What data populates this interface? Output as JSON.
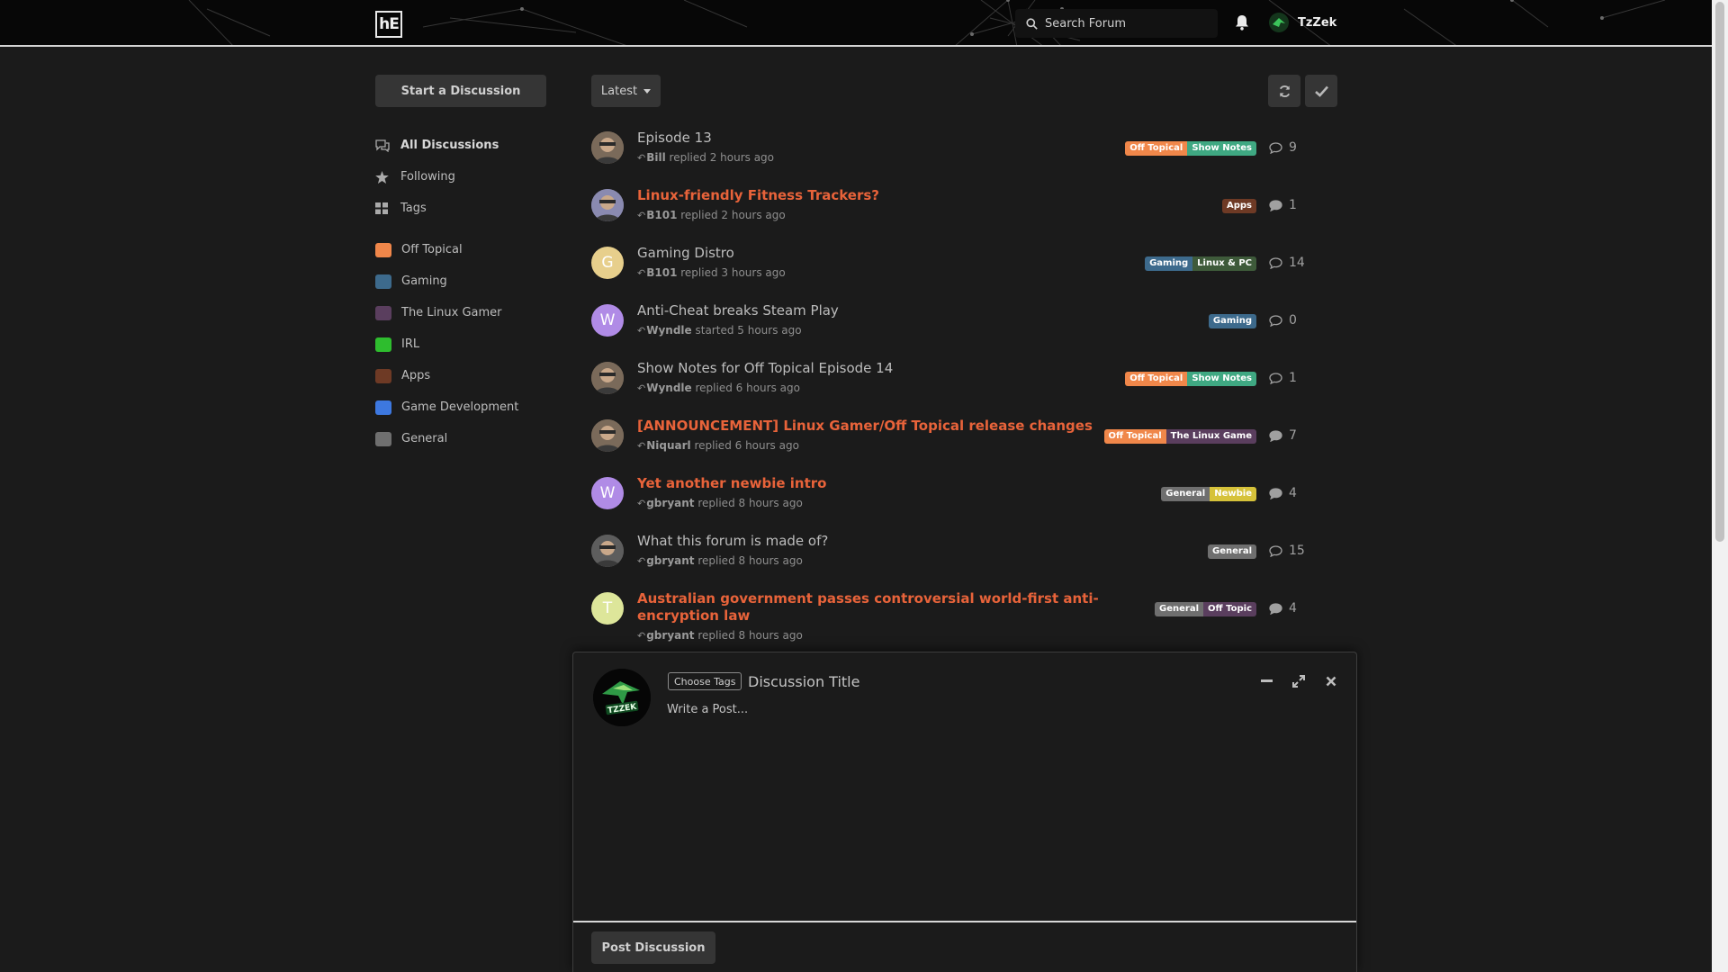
{
  "colors": {
    "accent_unread": "#e8633a",
    "background": "#1b1b1b",
    "header_bg": "#070707"
  },
  "header": {
    "logo_text": "hE",
    "search_placeholder": "Search Forum",
    "username": "TzZek"
  },
  "sidebar": {
    "start_label": "Start a Discussion",
    "nav": [
      {
        "label": "All Discussions",
        "icon": "comments-icon"
      },
      {
        "label": "Following",
        "icon": "star-icon"
      },
      {
        "label": "Tags",
        "icon": "tags-grid-icon"
      }
    ],
    "tags": [
      {
        "label": "Off Topical",
        "color": "#f0874a"
      },
      {
        "label": "Gaming",
        "color": "#3d6a8c"
      },
      {
        "label": "The Linux Gamer",
        "color": "#5a3e5e"
      },
      {
        "label": "IRL",
        "color": "#2ebd2e"
      },
      {
        "label": "Apps",
        "color": "#6e3a25"
      },
      {
        "label": "Game Development",
        "color": "#3d78e0"
      },
      {
        "label": "General",
        "color": "#6f6f6f"
      }
    ]
  },
  "toolbar": {
    "sort_label": "Latest",
    "refresh_icon": "refresh-icon",
    "mark_read_icon": "check-icon"
  },
  "discussions": [
    {
      "title": "Episode 13",
      "user": "Bill",
      "action": "replied 2 hours ago",
      "tags": [
        {
          "label": "Off Topical",
          "color": "#f0874a"
        },
        {
          "label": "Show Notes",
          "color": "#3fa882"
        }
      ],
      "count": "9",
      "unread": false,
      "avatar": {
        "type": "photo",
        "color": "#7a6a5a"
      }
    },
    {
      "title": "Linux-friendly Fitness Trackers?",
      "user": "B101",
      "action": "replied 2 hours ago",
      "tags": [
        {
          "label": "Apps",
          "color": "#6e3a25"
        }
      ],
      "count": "1",
      "unread": true,
      "avatar": {
        "type": "photo",
        "color": "#8a8ab0"
      }
    },
    {
      "title": "Gaming Distro",
      "user": "B101",
      "action": "replied 3 hours ago",
      "tags": [
        {
          "label": "Gaming",
          "color": "#3d6a8c"
        },
        {
          "label": "Linux & PC",
          "color": "#3e5a3a"
        }
      ],
      "count": "14",
      "unread": false,
      "avatar": {
        "type": "letter",
        "letter": "G",
        "color": "#e7cf8c"
      }
    },
    {
      "title": "Anti-Cheat breaks Steam Play",
      "user": "Wyndle",
      "action": "started 5 hours ago",
      "tags": [
        {
          "label": "Gaming",
          "color": "#3d6a8c"
        }
      ],
      "count": "0",
      "unread": false,
      "avatar": {
        "type": "letter",
        "letter": "W",
        "color": "#b08be6"
      }
    },
    {
      "title": "Show Notes for Off Topical Episode 14",
      "user": "Wyndle",
      "action": "replied 6 hours ago",
      "tags": [
        {
          "label": "Off Topical",
          "color": "#f0874a"
        },
        {
          "label": "Show Notes",
          "color": "#3fa882"
        }
      ],
      "count": "1",
      "unread": false,
      "avatar": {
        "type": "photo",
        "color": "#7a6a5a"
      }
    },
    {
      "title": "[ANNOUNCEMENT] Linux Gamer/Off Topical release changes",
      "user": "Niquarl",
      "action": "replied 6 hours ago",
      "tags": [
        {
          "label": "Off Topical",
          "color": "#f0874a"
        },
        {
          "label": "The Linux Game",
          "color": "#5a3e5e"
        }
      ],
      "count": "7",
      "unread": true,
      "avatar": {
        "type": "photo",
        "color": "#7a6a5a"
      }
    },
    {
      "title": "Yet another newbie intro",
      "user": "gbryant",
      "action": "replied 8 hours ago",
      "tags": [
        {
          "label": "General",
          "color": "#6f6f6f"
        },
        {
          "label": "Newbie",
          "color": "#d6c23a"
        }
      ],
      "count": "4",
      "unread": true,
      "avatar": {
        "type": "letter",
        "letter": "W",
        "color": "#b08be6"
      }
    },
    {
      "title": "What this forum is made of?",
      "user": "gbryant",
      "action": "replied 8 hours ago",
      "tags": [
        {
          "label": "General",
          "color": "#6f6f6f"
        }
      ],
      "count": "15",
      "unread": false,
      "avatar": {
        "type": "photo",
        "color": "#5d5d5d"
      }
    },
    {
      "title": "Australian government passes controversial world-first anti-encryption law",
      "user": "gbryant",
      "action": "replied 8 hours ago",
      "tags": [
        {
          "label": "General",
          "color": "#6f6f6f"
        },
        {
          "label": "Off Topic",
          "color": "#5a3e5e"
        }
      ],
      "count": "4",
      "unread": true,
      "avatar": {
        "type": "letter",
        "letter": "T",
        "color": "#dde69a"
      }
    }
  ],
  "composer": {
    "choose_tags_label": "Choose Tags",
    "title_placeholder": "Discussion Title",
    "post_placeholder": "Write a Post...",
    "post_button_label": "Post Discussion",
    "avatar_text": "TZZEK"
  }
}
